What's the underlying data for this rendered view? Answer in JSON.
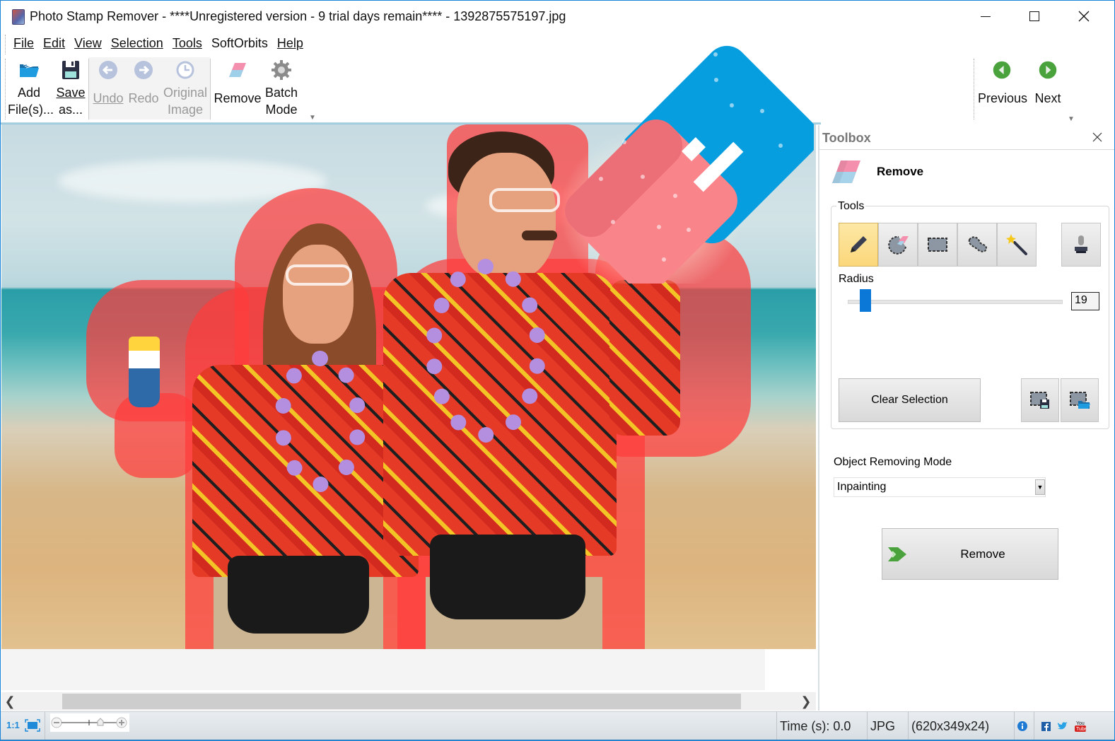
{
  "window": {
    "title": "Photo Stamp Remover - ****Unregistered version - 9 trial days remain**** - 1392875575197.jpg",
    "controls": [
      "minimize",
      "maximize",
      "close"
    ]
  },
  "menu": [
    {
      "label": "File",
      "accel": "F"
    },
    {
      "label": "Edit",
      "accel": "E"
    },
    {
      "label": "View",
      "accel": "V"
    },
    {
      "label": "Selection",
      "accel": "S"
    },
    {
      "label": "Tools",
      "accel": "T"
    },
    {
      "label": "SoftOrbits",
      "accel": ""
    },
    {
      "label": "Help",
      "accel": "H"
    }
  ],
  "toolbar": {
    "add_files": {
      "line1": "Add",
      "line2": "File(s)...",
      "icon": "open-folder-icon",
      "enabled": true
    },
    "save_as": {
      "line1": "Save",
      "line2": "as...",
      "icon": "floppy-disk-icon",
      "enabled": true
    },
    "undo": {
      "label": "Undo",
      "icon": "undo-arrow-icon",
      "enabled": false
    },
    "redo": {
      "label": "Redo",
      "icon": "redo-arrow-icon",
      "enabled": false
    },
    "original_image": {
      "line1": "Original",
      "line2": "Image",
      "icon": "clock-icon",
      "enabled": false
    },
    "remove": {
      "label": "Remove",
      "icon": "eraser-icon",
      "enabled": true
    },
    "batch_mode": {
      "line1": "Batch",
      "line2": "Mode",
      "icon": "gear-icon",
      "enabled": true
    },
    "previous": {
      "label": "Previous",
      "icon": "green-left-arrow-icon"
    },
    "next": {
      "label": "Next",
      "icon": "green-right-arrow-icon"
    }
  },
  "canvas": {
    "image_description": "Beach photo of a man and woman in Hawaiian shirts with leis, subjects covered by red removal mask",
    "mask_color": "#ff3c3c"
  },
  "toolbox": {
    "title": "Toolbox",
    "section_title": "Remove",
    "tools_group_label": "Tools",
    "tools": [
      {
        "name": "pencil",
        "icon": "pencil-icon",
        "active": true
      },
      {
        "name": "eraser-selection",
        "icon": "selection-eraser-icon",
        "active": false
      },
      {
        "name": "rectangle-selection",
        "icon": "rectangle-selection-icon",
        "active": false
      },
      {
        "name": "lasso-selection",
        "icon": "lasso-selection-icon",
        "active": false
      },
      {
        "name": "magic-wand",
        "icon": "magic-wand-icon",
        "active": false
      },
      {
        "name": "stamp",
        "icon": "stamp-icon",
        "active": false
      }
    ],
    "radius_label": "Radius",
    "radius_value": "19",
    "radius_slider_fraction": 0.06,
    "clear_selection_label": "Clear Selection",
    "save_selection_icon": "save-selection-icon",
    "load_selection_icon": "load-selection-icon",
    "mode_label": "Object Removing Mode",
    "mode_value": "Inpainting",
    "remove_button_label": "Remove"
  },
  "statusbar": {
    "zoom_1to1": "1:1",
    "time": "Time (s): 0.0",
    "format": "JPG",
    "dimensions": "(620x349x24)",
    "social": [
      "info-icon",
      "facebook-icon",
      "twitter-icon",
      "youtube-icon"
    ]
  },
  "colors": {
    "accent_blue": "#0b78d7",
    "active_tool_bg": "#fbd77a",
    "eraser_pink": "#f9848a",
    "eraser_blue": "#079ee0",
    "nav_green": "#4aa23c"
  }
}
